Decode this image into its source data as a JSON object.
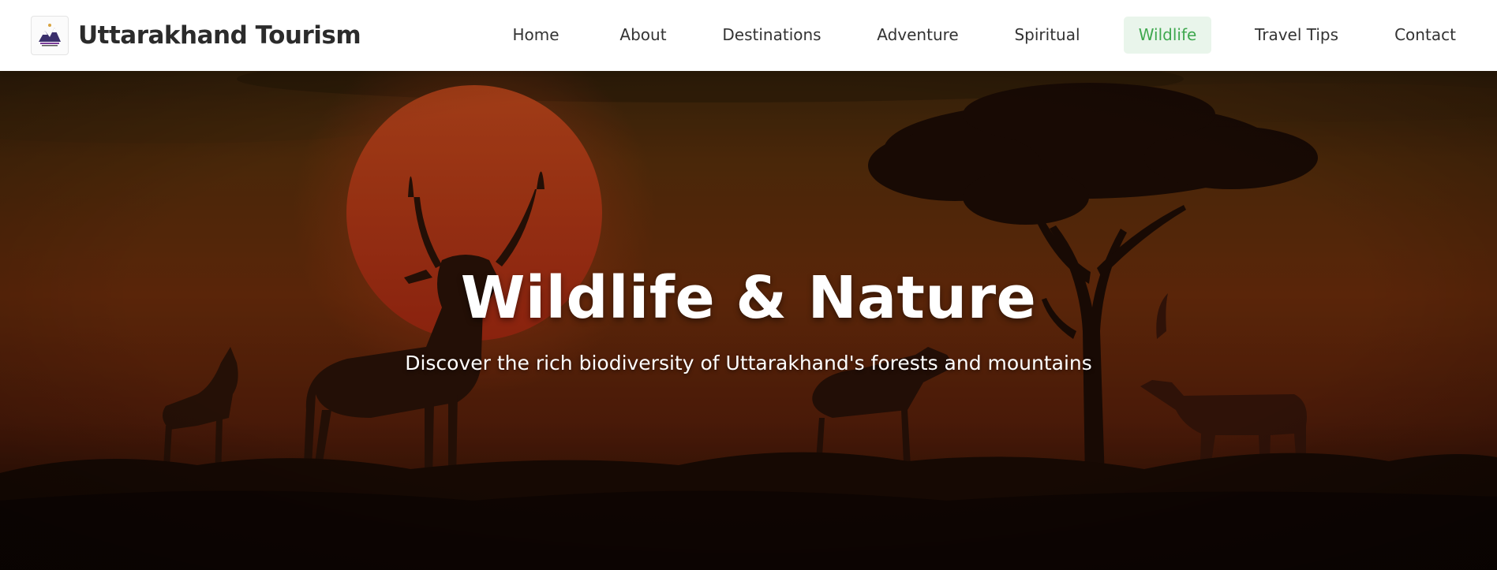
{
  "header": {
    "brand_name": "Uttarakhand Tourism",
    "logo_icon": "tourism-emblem-icon"
  },
  "nav": {
    "items": [
      {
        "label": "Home"
      },
      {
        "label": "About"
      },
      {
        "label": "Destinations"
      },
      {
        "label": "Adventure"
      },
      {
        "label": "Spiritual"
      },
      {
        "label": "Wildlife",
        "active": true
      },
      {
        "label": "Travel Tips"
      },
      {
        "label": "Contact"
      }
    ]
  },
  "hero": {
    "title": "Wildlife & Nature",
    "subtitle": "Discover the rich biodiversity of Uttarakhand's forests and mountains",
    "image": "sunset-savanna-antelopes-acacia-tree"
  },
  "colors": {
    "active_nav_text": "#3fa84f",
    "active_nav_bg": "#e9f5eb",
    "sky_orange": "#7a3a0c",
    "sun_red": "#c0381a"
  }
}
